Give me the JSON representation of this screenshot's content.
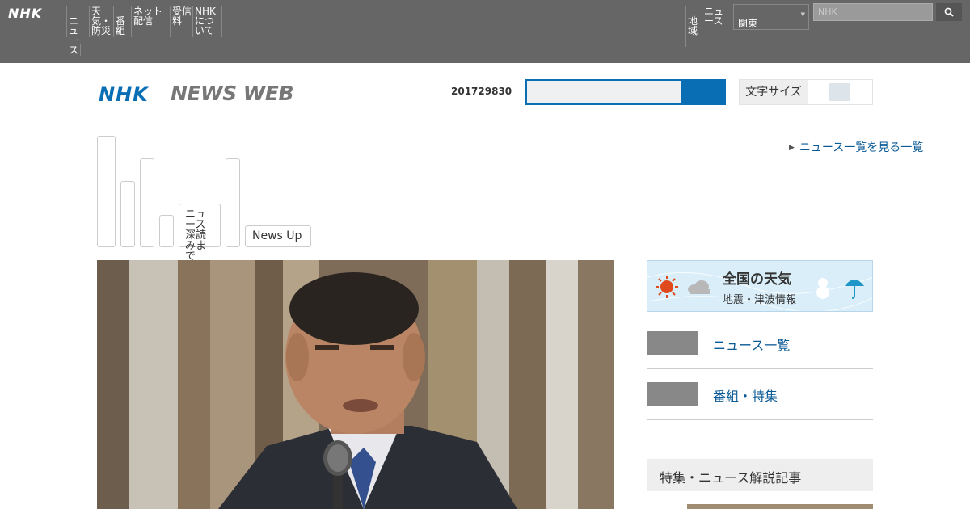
{
  "global_nav": {
    "logo": "NHK",
    "items": [
      "ニュース",
      "天気・防災",
      "番組",
      "ネット配信",
      "受信料",
      "NHK について"
    ],
    "right_items": [
      "地域",
      "ニュース"
    ],
    "region_value": "関東",
    "search_placeholder": "NHK"
  },
  "header": {
    "logo_nhk": "NHK",
    "logo_news": "NEWS WEB",
    "date_number": "201729830",
    "toggle_label": "文字サイズ"
  },
  "top_link": "ニュース一覧を見る一覧",
  "tabs": [
    {
      "label": "",
      "name": "tab-1"
    },
    {
      "label": "",
      "name": "tab-2"
    },
    {
      "label": "",
      "name": "tab-3"
    },
    {
      "label": "",
      "name": "tab-4"
    },
    {
      "label": "ニュース深読みまで",
      "name": "tab-5"
    },
    {
      "label": "",
      "name": "tab-6"
    },
    {
      "label": "News Up",
      "name": "tab-news-up"
    }
  ],
  "weather": {
    "title": "全国の天気",
    "subtitle": "地震・津波情報"
  },
  "side_links": [
    "ニュース一覧",
    "番組・特集"
  ],
  "side_heading": "特集・ニュース解説記事",
  "colors": {
    "brand_blue": "#0a6eb4",
    "topbar_grey": "#666666",
    "link_blue": "#0a5a96"
  }
}
